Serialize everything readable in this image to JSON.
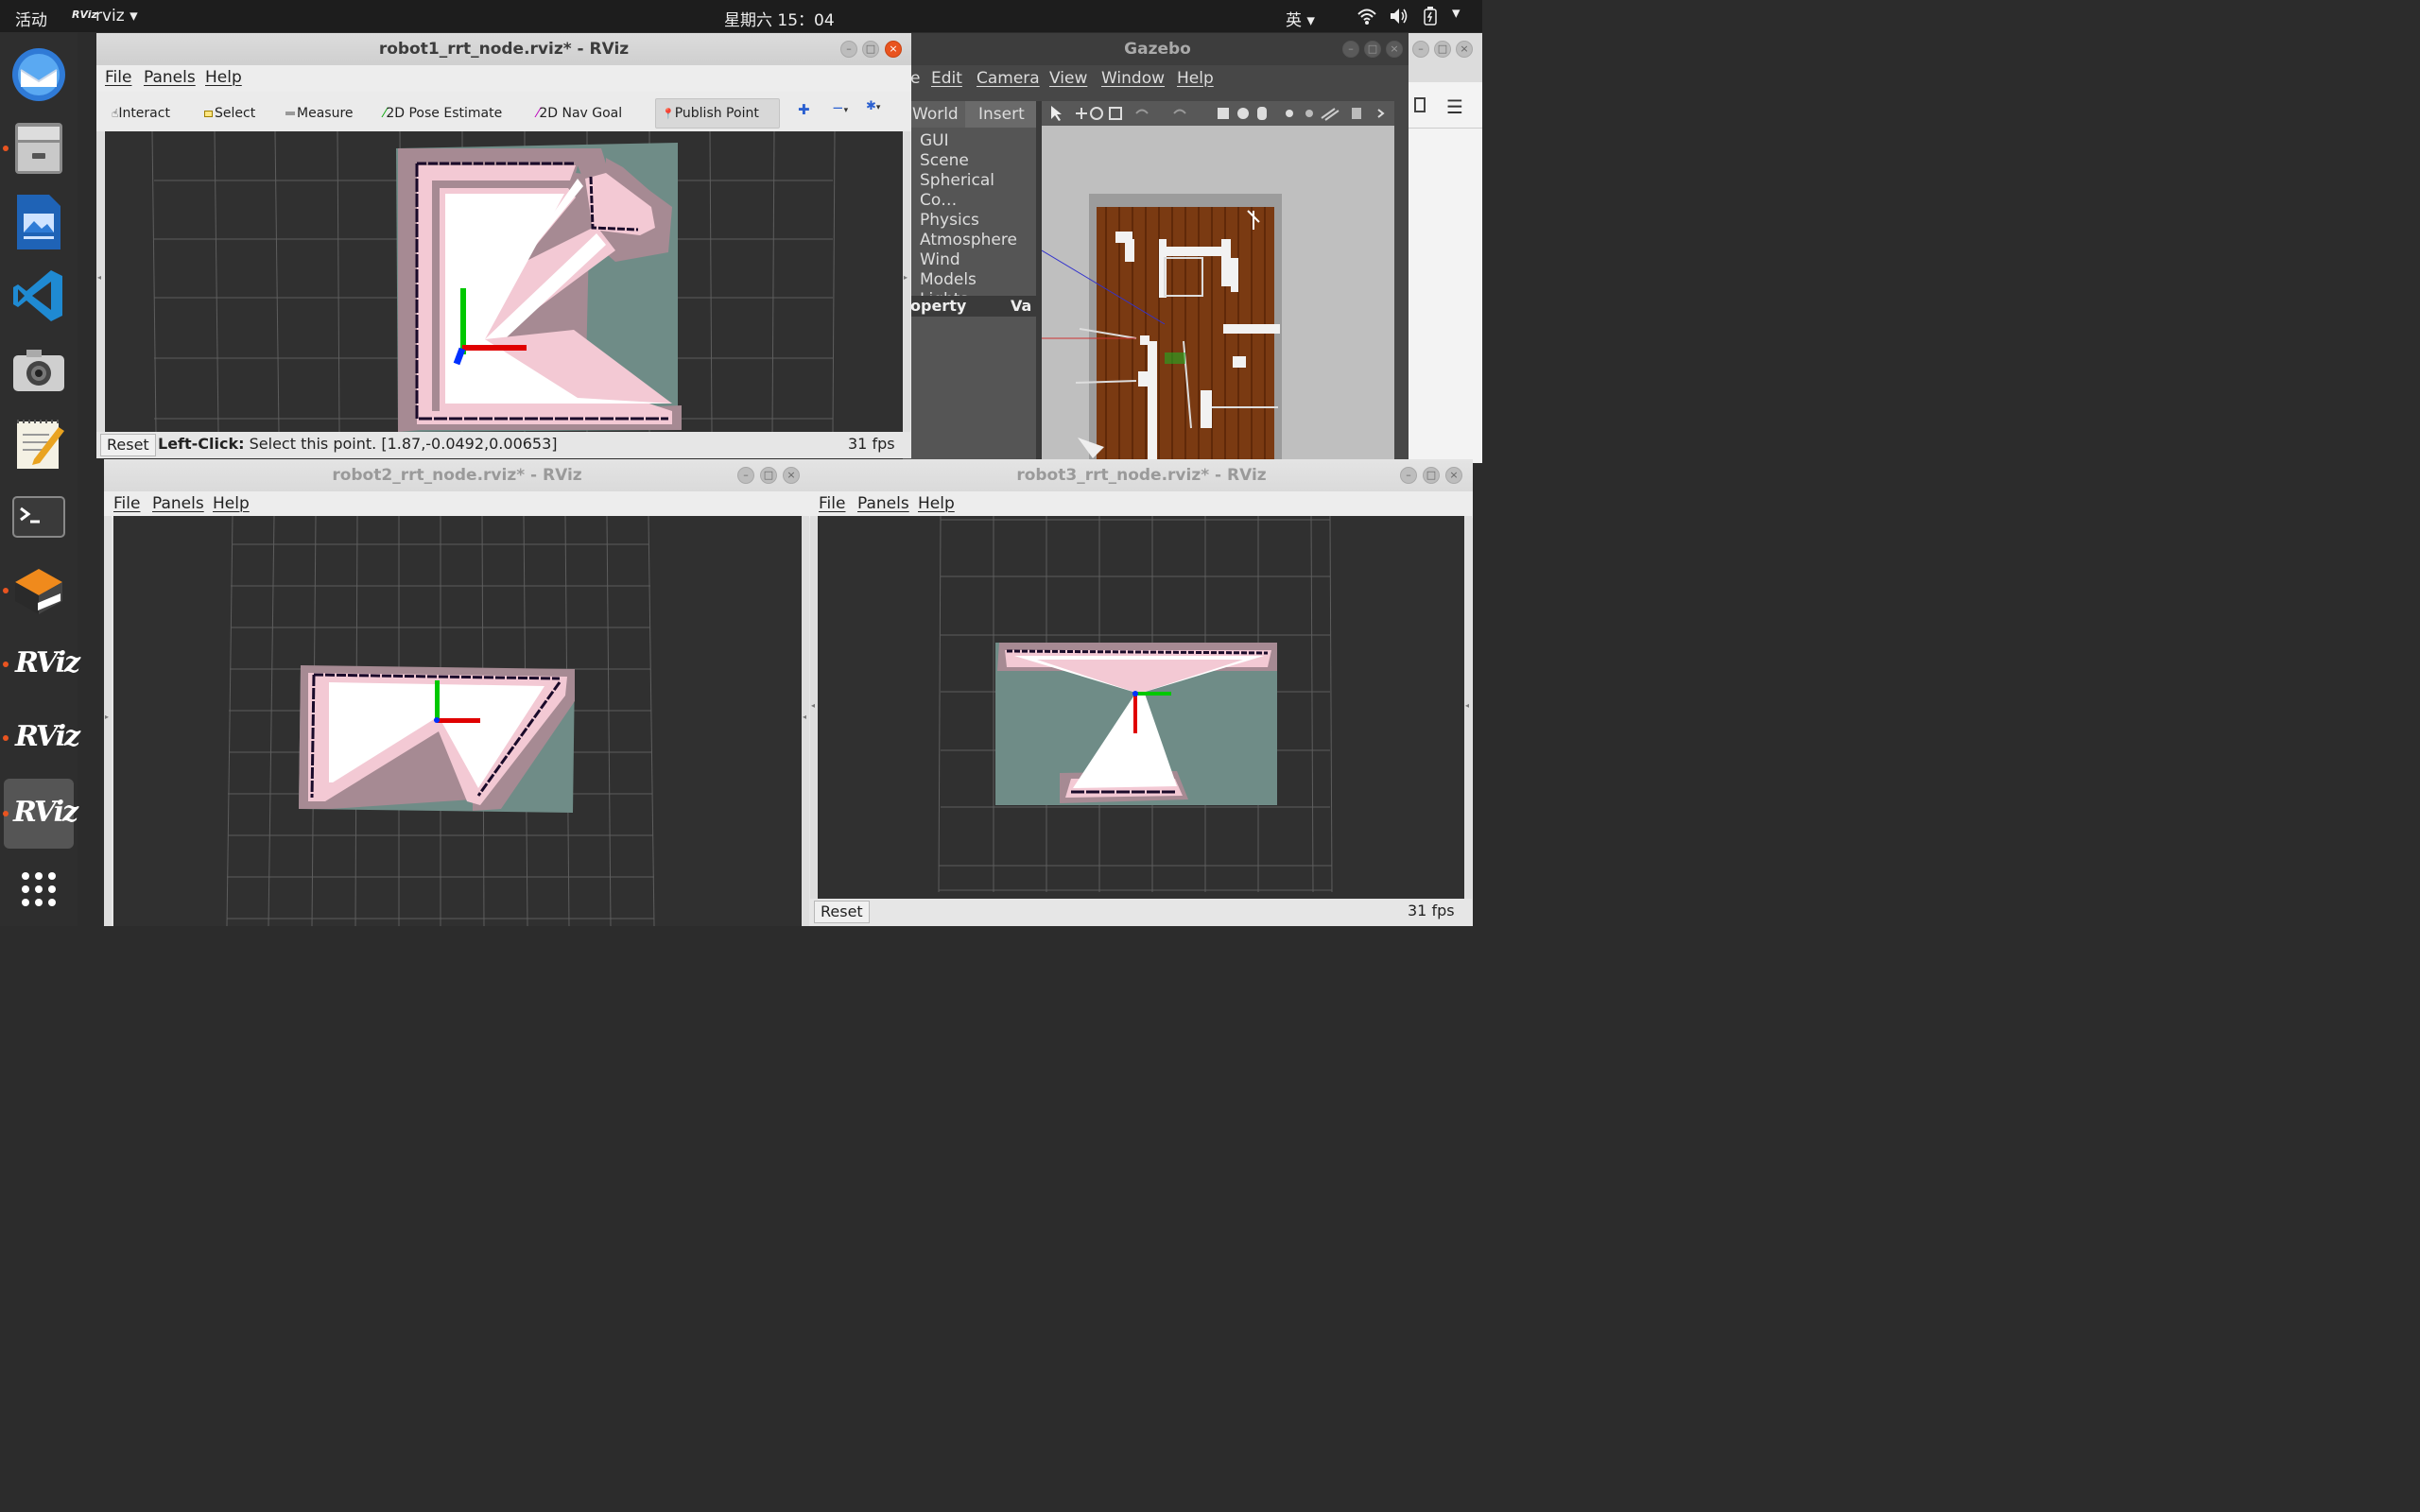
{
  "topbar": {
    "activities": "活动",
    "app_icon": "RViz",
    "app_name": "rviz",
    "clock": "星期六 15：04",
    "input_method": "英"
  },
  "dock": {
    "items": [
      "thunderbird-icon",
      "files-icon",
      "document-viewer-icon",
      "vscode-icon",
      "camera-icon",
      "text-editor-icon",
      "terminal-icon",
      "box-app-icon",
      "rviz-icon",
      "rviz-icon",
      "rviz-icon",
      "show-apps-icon"
    ],
    "rviz_label": "RViz"
  },
  "rviz1": {
    "title": "robot1_rrt_node.rviz* - RViz",
    "menu": {
      "file": "File",
      "panels": "Panels",
      "help": "Help"
    },
    "tools": {
      "interact": "Interact",
      "select": "Select",
      "measure": "Measure",
      "pose_estimate": "2D Pose Estimate",
      "nav_goal": "2D Nav Goal",
      "publish_point": "Publish Point"
    },
    "status": {
      "reset": "Reset",
      "hint_bold": "Left-Click:",
      "hint_text": " Select this point. [1.87,-0.0492,0.00653]",
      "fps": "31 fps"
    }
  },
  "rviz2": {
    "title": "robot2_rrt_node.rviz* - RViz",
    "menu": {
      "file": "File",
      "panels": "Panels",
      "help": "Help"
    }
  },
  "rviz3": {
    "title": "robot3_rrt_node.rviz* - RViz",
    "menu": {
      "file": "File",
      "panels": "Panels",
      "help": "Help"
    },
    "status": {
      "reset": "Reset",
      "fps": "31 fps"
    }
  },
  "gazebo": {
    "title": "Gazebo",
    "menu": {
      "file_partial": "e",
      "edit": "Edit",
      "camera": "Camera",
      "view": "View",
      "window": "Window",
      "help": "Help"
    },
    "tabs": {
      "world": "World",
      "insert": "Insert"
    },
    "tree": [
      "GUI",
      "Scene",
      "Spherical Co…",
      "Physics",
      "Atmosphere",
      "Wind",
      "Models",
      "Lights"
    ],
    "property_header": {
      "property": "operty",
      "value": "Va"
    }
  },
  "colors": {
    "free": "#ffffff",
    "unknown": "#6f8c87",
    "inflation": "#f3c9d4",
    "cost_border": "#a68a93",
    "wall": "#1a0a2a",
    "x_axis": "#e00000",
    "y_axis": "#00c800",
    "z_axis": "#0030ff",
    "ubuntu_orange": "#e95420"
  }
}
